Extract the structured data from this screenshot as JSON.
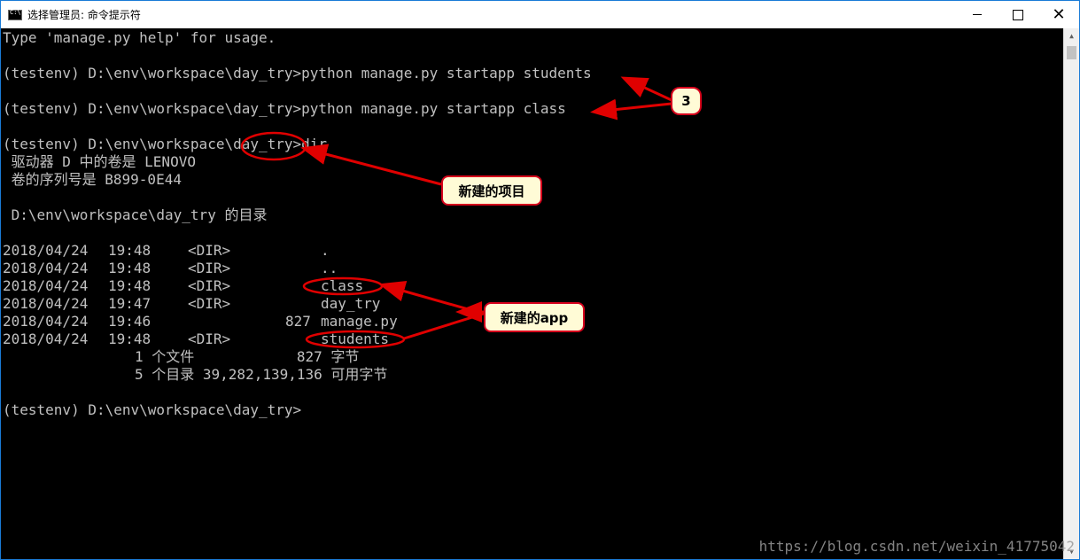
{
  "window": {
    "title": "选择管理员: 命令提示符",
    "icon": "cmd-icon",
    "buttons": {
      "minimize": "—",
      "maximize": "☐",
      "close": "✕"
    }
  },
  "console": {
    "lines": [
      "Type 'manage.py help' for usage.",
      "",
      "(testenv) D:\\env\\workspace\\day_try>python manage.py startapp students",
      "",
      "(testenv) D:\\env\\workspace\\day_try>python manage.py startapp class",
      "",
      "(testenv) D:\\env\\workspace\\day_try>dir",
      " 驱动器 D 中的卷是 LENOVO",
      " 卷的序列号是 B899-0E44",
      "",
      " D:\\env\\workspace\\day_try 的目录",
      ""
    ],
    "dir_entries": [
      {
        "date": "2018/04/24",
        "time": "19:48",
        "type": "<DIR>",
        "size": "",
        "name": "."
      },
      {
        "date": "2018/04/24",
        "time": "19:48",
        "type": "<DIR>",
        "size": "",
        "name": ".."
      },
      {
        "date": "2018/04/24",
        "time": "19:48",
        "type": "<DIR>",
        "size": "",
        "name": "class"
      },
      {
        "date": "2018/04/24",
        "time": "19:47",
        "type": "<DIR>",
        "size": "",
        "name": "day_try"
      },
      {
        "date": "2018/04/24",
        "time": "19:46",
        "type": "",
        "size": "827",
        "name": "manage.py"
      },
      {
        "date": "2018/04/24",
        "time": "19:48",
        "type": "<DIR>",
        "size": "",
        "name": "students"
      }
    ],
    "summary": [
      "1 个文件            827 字节",
      "5 个目录 39,282,139,136 可用字节"
    ],
    "prompt": "(testenv) D:\\env\\workspace\\day_try>"
  },
  "annotations": {
    "number_label": "3",
    "project_label": "新建的项目",
    "app_label": "新建的app",
    "color": "#e00000"
  },
  "watermark": "https://blog.csdn.net/weixin_41775042"
}
